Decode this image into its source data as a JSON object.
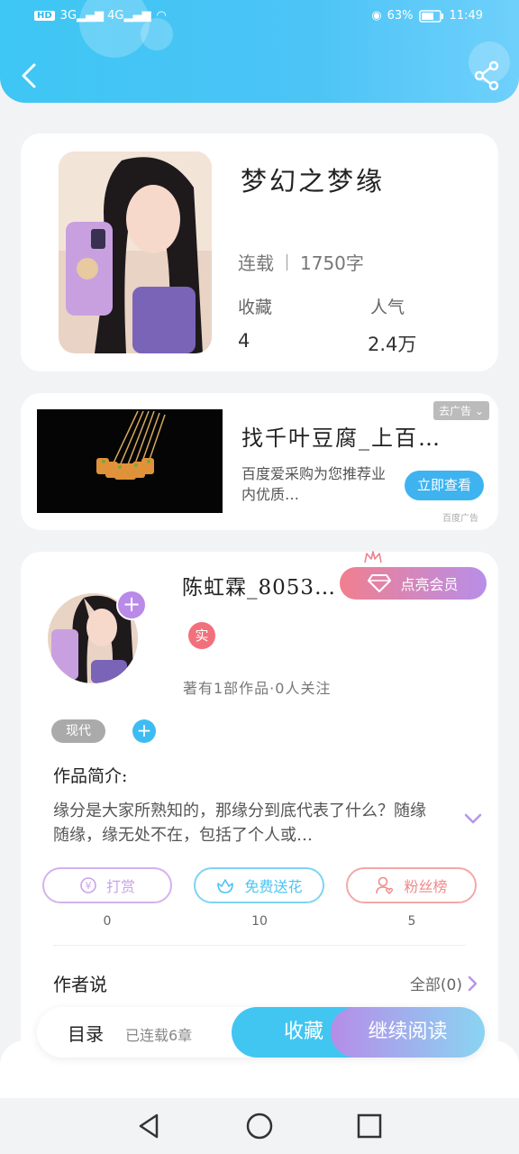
{
  "status_bar": {
    "network_left": "HD 2 3G 4G",
    "battery": "63%",
    "time": "11:49"
  },
  "book": {
    "title": "梦幻之梦缘",
    "status": "连载",
    "word_count": "1750字",
    "favorites_label": "收藏",
    "favorites_value": "4",
    "popularity_label": "人气",
    "popularity_value": "2.4万"
  },
  "ad": {
    "title": "找千叶豆腐_上百…",
    "desc": "百度爱采购为您推荐业内优质…",
    "close_label": "去广告",
    "button": "立即查看",
    "source": "百度广告"
  },
  "author": {
    "name": "陈虹霖_8053…",
    "vip_button": "点亮会员",
    "verify_badge": "实",
    "works_info": "著有1部作品·0人关注",
    "tag": "现代",
    "intro_label": "作品简介:",
    "intro_text": "缘分是大家所熟知的，那缘分到底代表了什么？随缘随缘，缘无处不在，包括了个人或…",
    "actions": [
      {
        "label": "打赏",
        "count": "0",
        "color": "#c9a3ea"
      },
      {
        "label": "免费送花",
        "count": "10",
        "color": "#4cc4f2"
      },
      {
        "label": "粉丝榜",
        "count": "5",
        "color": "#f08a8a"
      }
    ],
    "author_says": "作者说",
    "all_link": "全部(0)"
  },
  "bottom": {
    "toc": "目录",
    "chapters": "已连载6章",
    "favorite": "收藏",
    "continue": "继续阅读"
  }
}
